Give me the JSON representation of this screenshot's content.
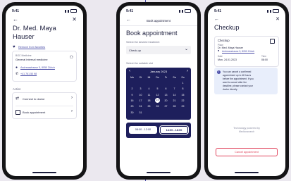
{
  "status_time": "9:41",
  "phone1": {
    "doctor_name_line1": "Dr. Med. Maya",
    "doctor_name_line2": "Hauser",
    "remove_favorites": "Remove from favorites",
    "specialty_caption": "BGC Medicine",
    "specialty": "General internal medicine",
    "address_link": "Andreasstrasse 5, 8050 Zürich",
    "phone_link": "+41 761 50 98",
    "action_heading": "Action",
    "actions": [
      {
        "label": "Connect to doctor",
        "icon": "connect-icon"
      },
      {
        "label": "Book appointment",
        "icon": "calendar-icon"
      }
    ]
  },
  "phone2": {
    "nav_title": "Book appointment",
    "heading": "Book appointment",
    "treatment_label": "Select the desired treatment",
    "treatment_value": "Check-up",
    "slot_label": "Select the suitable slot",
    "calendar": {
      "month": "January 2023",
      "weekdays": [
        "Mo",
        "Di",
        "Mi",
        "Do",
        "Fr",
        "Sa",
        "So"
      ],
      "rows": [
        [
          "",
          "",
          "",
          "",
          "",
          "",
          "1"
        ],
        [
          "2",
          "3",
          "4",
          "5",
          "6",
          "7",
          "8"
        ],
        [
          "9",
          "10",
          "11",
          "12",
          "13",
          "14",
          "15"
        ],
        [
          "16",
          "17",
          "18",
          "19",
          "20",
          "21",
          "22"
        ],
        [
          "23",
          "24",
          "25",
          "26",
          "27",
          "28",
          "29"
        ],
        [
          "30",
          "31",
          "",
          "",
          "",
          "",
          ""
        ]
      ],
      "selected_day": "19"
    },
    "time_slots": [
      "08:00 - 12:00",
      "14:00 - 18:00"
    ],
    "selected_slot_index": 1
  },
  "phone3": {
    "heading": "Checkup",
    "card_title": "Checkup",
    "place_label": "Place",
    "place_value": "Dr. Med. Maya Hauser",
    "place_link": "Andreasstrasse 5, 8050 Zürich",
    "date_label": "Date",
    "date_value": "Mon, 24.01.2023",
    "time_label": "Time",
    "time_value": "08:00",
    "info_text": [
      "You can cancel a confirmed",
      "appointment up to 48 hours",
      "before the appointment. If you",
      "want to cancel after the",
      "deadline, please contact your",
      "doctor directly."
    ],
    "powered_line1": "Technology powered by",
    "powered_line2": "Medicosearch",
    "cancel_button": "Cancel appointment"
  },
  "colors": {
    "accent": "#4b4ea8",
    "navy": "#1e1f5c",
    "danger": "#e0435b",
    "info_bg": "#e8eefb"
  }
}
